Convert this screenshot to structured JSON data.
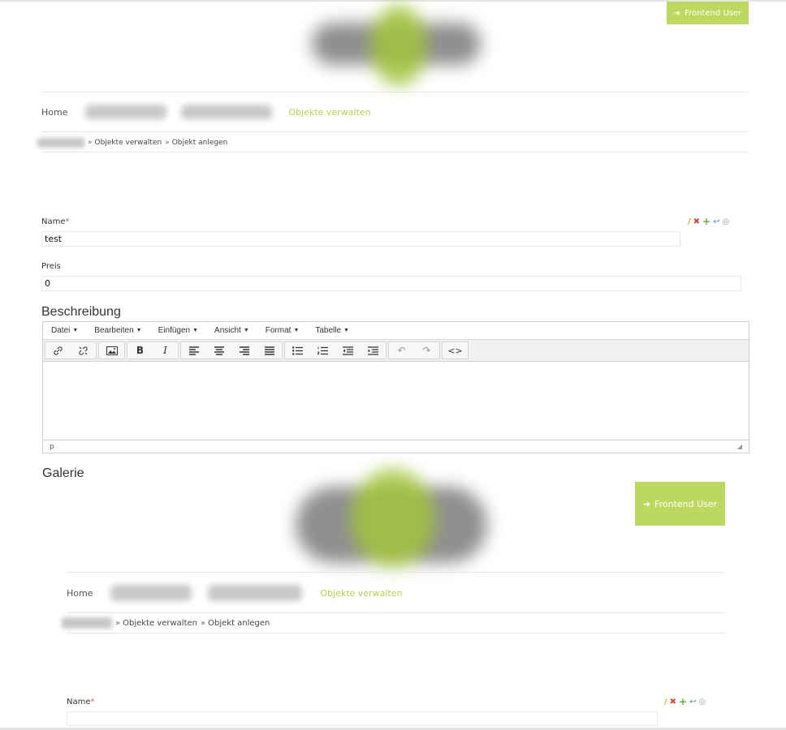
{
  "header": {
    "frontend_user_label": "Frontend User",
    "nav": {
      "home": "Home",
      "active": "Objekte verwalten"
    },
    "breadcrumb": {
      "sep": "»",
      "item1": "Objekte verwalten",
      "item2": "Objekt anlegen"
    }
  },
  "form": {
    "name_label": "Name",
    "required_mark": "*",
    "name_value": "test",
    "price_label": "Preis",
    "price_value": "0",
    "description_title": "Beschreibung",
    "gallery_title": "Galerie"
  },
  "editor": {
    "menus": [
      "Datei",
      "Bearbeiten",
      "Einfügen",
      "Ansicht",
      "Format",
      "Tabelle"
    ],
    "status_path": "p"
  },
  "embedded": {
    "frontend_user_label": "Frontend User",
    "nav_home": "Home",
    "nav_active": "Objekte verwalten",
    "crumb1": "Objekte verwalten",
    "crumb2": "Objekt anlegen",
    "name_label": "Name",
    "name_value": ""
  },
  "icons": {
    "edit": "pencil-icon",
    "delete": "x-icon",
    "add": "plus-icon",
    "move": "move-icon",
    "view": "eye-icon"
  },
  "colors": {
    "accent": "#bcd85f",
    "accent_text": "#b4d14f",
    "required": "#d9534f"
  }
}
